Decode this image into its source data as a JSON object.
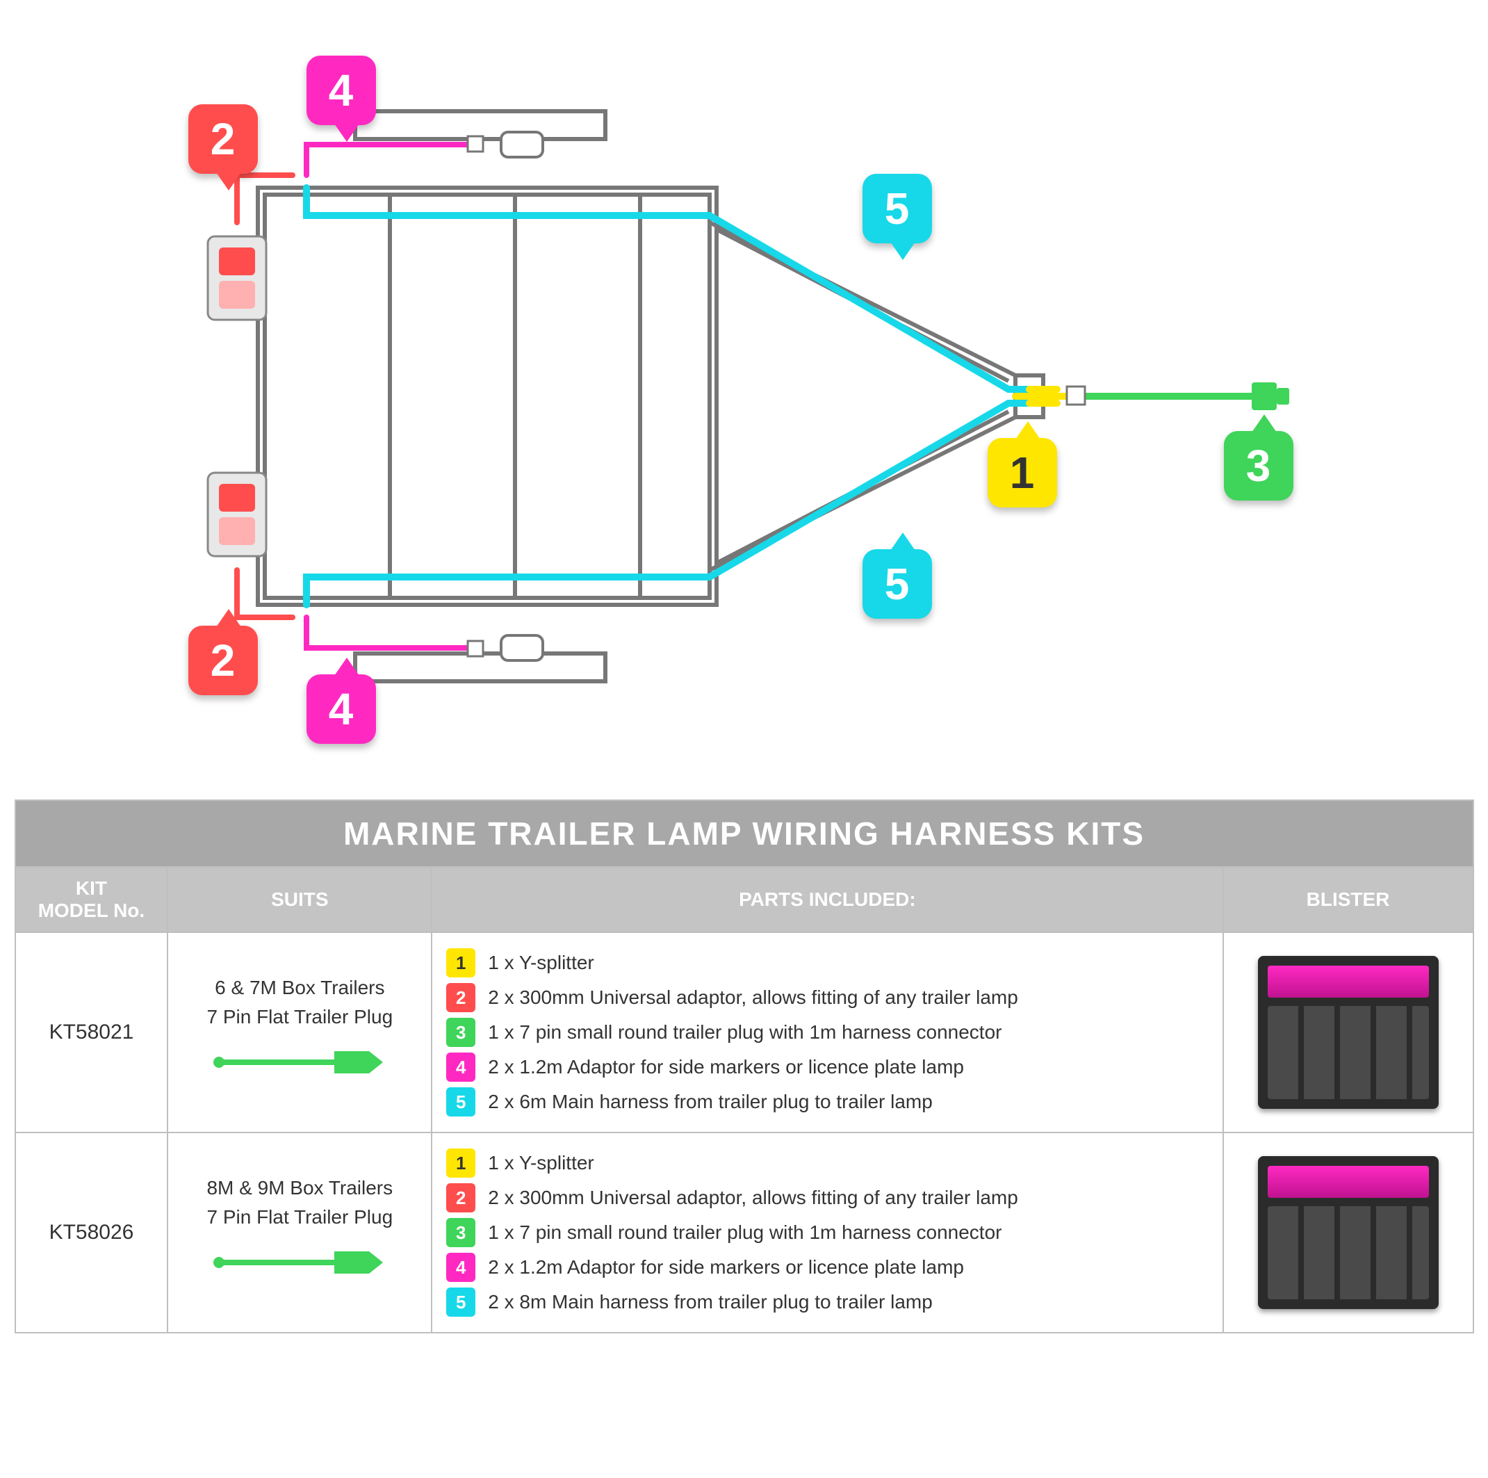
{
  "diagram": {
    "callouts": {
      "c1": "1",
      "c2_top": "2",
      "c2_bottom": "2",
      "c3": "3",
      "c4_top": "4",
      "c4_bottom": "4",
      "c5_top": "5",
      "c5_bottom": "5"
    }
  },
  "table": {
    "title": "MARINE TRAILER LAMP WIRING HARNESS KITS",
    "headers": {
      "model": "KIT MODEL No.",
      "suits": "SUITS",
      "parts": "PARTS INCLUDED:",
      "blister": "BLISTER"
    },
    "rows": [
      {
        "model": "KT58021",
        "suits_line1": "6 & 7M Box Trailers",
        "suits_line2": "7 Pin Flat Trailer Plug",
        "parts": [
          {
            "n": "1",
            "txt": "1 x Y-splitter"
          },
          {
            "n": "2",
            "txt": "2 x 300mm Universal adaptor, allows fitting of any trailer lamp"
          },
          {
            "n": "3",
            "txt": "1 x 7 pin small round trailer plug with 1m harness connector"
          },
          {
            "n": "4",
            "txt": "2 x 1.2m Adaptor for side markers or licence plate lamp"
          },
          {
            "n": "5",
            "txt": "2 x 6m Main harness from trailer plug to trailer lamp"
          }
        ]
      },
      {
        "model": "KT58026",
        "suits_line1": "8M & 9M Box Trailers",
        "suits_line2": "7 Pin Flat Trailer Plug",
        "parts": [
          {
            "n": "1",
            "txt": "1 x Y-splitter"
          },
          {
            "n": "2",
            "txt": "2 x 300mm Universal adaptor, allows fitting of any trailer lamp"
          },
          {
            "n": "3",
            "txt": "1 x 7 pin small round trailer plug with 1m harness connector"
          },
          {
            "n": "4",
            "txt": "2 x 1.2m Adaptor for side markers or licence plate lamp"
          },
          {
            "n": "5",
            "txt": "2 x 8m Main harness from trailer plug to trailer lamp"
          }
        ]
      }
    ]
  },
  "colors": {
    "1": "#ffe600",
    "2": "#ff4d4d",
    "3": "#3fd45a",
    "4": "#ff29c2",
    "5": "#17d8e8"
  }
}
